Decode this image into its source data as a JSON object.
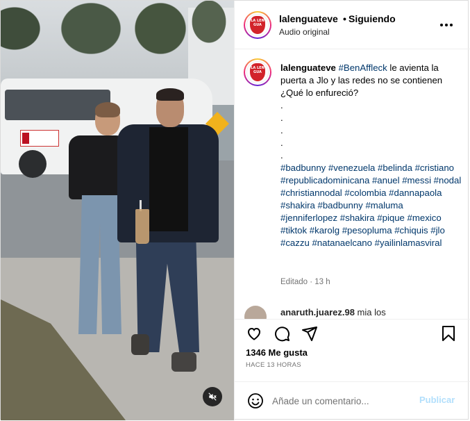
{
  "post": {
    "media": {
      "mute_icon": "speaker-muted-icon"
    },
    "header": {
      "username": "lalenguateve",
      "separator": "•",
      "follow_status": "Siguiendo",
      "audio": "Audio original",
      "more_icon": "more-horizontal-icon"
    },
    "avatar": {
      "logo_text": "LA LEN GUA"
    },
    "caption": {
      "username": "lalenguateve",
      "hashtag_lead": "#BenAffleck",
      "text": " le avienta la puerta a Jlo y las redes no se contienen ¿Qué lo enfureció?",
      "dots": [
        ".",
        ".",
        ".",
        ".",
        "."
      ],
      "hashtags": "#badbunny #venezuela #belinda #cristiano #republicadominicana #anuel #messi #nodal #christiannodal #colombia #dannapaola #shakira #badbunny #maluma #jenniferlopez #shakira #pique #mexico #tiktok #karolg #pesopluma #chiquis #jlo #cazzu #natanaelcano #yailinlamasviral",
      "edited": "Editado",
      "time_ago": "13 h"
    },
    "comment_preview": {
      "username": "anaruth.juarez.98",
      "text": " mia los"
    },
    "actions": {
      "like_icon": "heart-icon",
      "comment_icon": "comment-bubble-icon",
      "share_icon": "send-paper-plane-icon",
      "save_icon": "bookmark-icon",
      "likes": "1346 Me gusta",
      "timestamp": "HACE 13 HORAS"
    },
    "comment_bar": {
      "emoji_icon": "emoji-smile-icon",
      "placeholder": "Añade un comentario...",
      "post_label": "Publicar",
      "post_color": "#b2dffc"
    }
  }
}
